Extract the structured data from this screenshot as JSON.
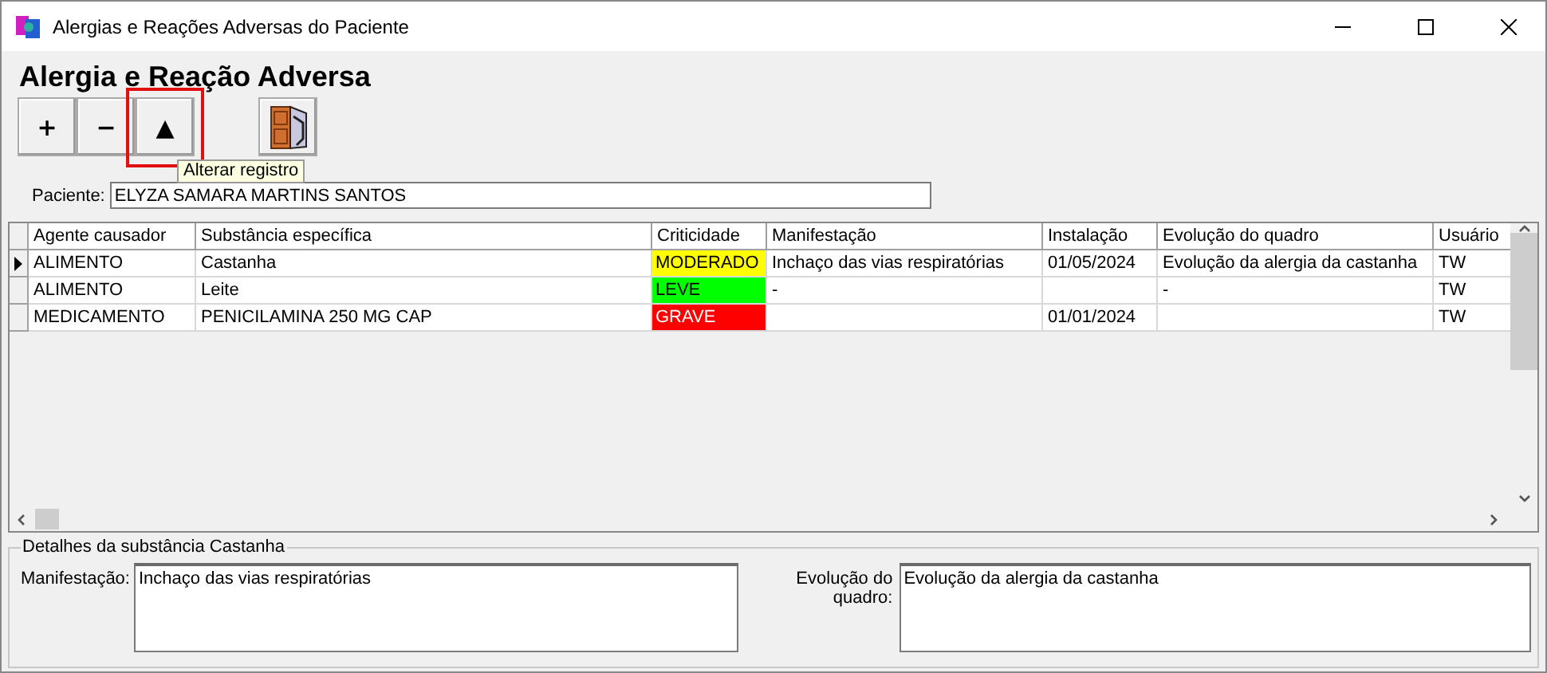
{
  "window": {
    "title": "Alergias e Reações Adversas do Paciente"
  },
  "heading": "Alergia e Reação Adversa",
  "toolbar": [
    {
      "label": "+",
      "kind": "text",
      "highlighted": false
    },
    {
      "label": "−",
      "kind": "text",
      "highlighted": false
    },
    {
      "label": "▲",
      "kind": "text",
      "highlighted": true
    },
    {
      "kind": "exit",
      "highlighted": false
    }
  ],
  "tooltip": "Alterar registro",
  "patient": {
    "label": "Paciente:",
    "value": "ELYZA SAMARA MARTINS SANTOS"
  },
  "table": {
    "columns": [
      "Agente causador",
      "Substância específica",
      "Criticidade",
      "Manifestação",
      "Instalação",
      "Evolução do quadro",
      "Usuário"
    ],
    "rows": [
      {
        "selected": true,
        "cells": [
          "ALIMENTO",
          "Castanha",
          "MODERADO",
          "Inchaço das vias respiratórias",
          "01/05/2024",
          "Evolução da alergia da castanha",
          "TW"
        ],
        "color": "#ffff00"
      },
      {
        "selected": false,
        "cells": [
          "ALIMENTO",
          "Leite",
          "LEVE",
          "-",
          "",
          "-",
          "TW"
        ],
        "color": "#00ff00"
      },
      {
        "selected": false,
        "cells": [
          "MEDICAMENTO",
          "PENICILAMINA 250 MG CAP",
          "GRAVE",
          "",
          "01/01/2024",
          "",
          "TW"
        ],
        "color": "#ff0000"
      }
    ]
  },
  "details": {
    "title": "Detalhes da substância Castanha",
    "manifest_label": "Manifestação:",
    "manifest_value": "Inchaço das vias respiratórias",
    "evolution_label": "Evolução do quadro:",
    "evolution_value": "Evolução da alergia da castanha"
  }
}
